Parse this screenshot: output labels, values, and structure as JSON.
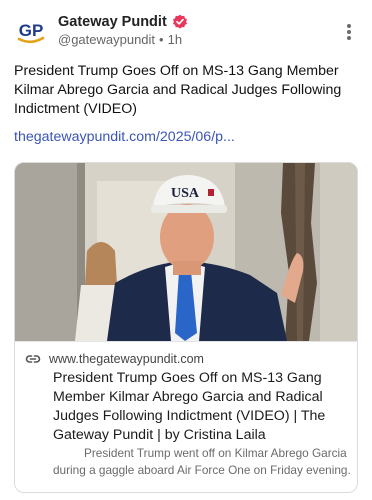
{
  "account": {
    "display_name": "Gateway Pundit",
    "handle": "@gatewaypundit",
    "separator": "•",
    "timestamp": "1h",
    "avatar_text": "GP",
    "verified": true
  },
  "post": {
    "text": "President Trump Goes Off on MS-13 Gang Member Kilmar Abrego Garcia and Radical Judges Following Indictment (VIDEO)",
    "link_text": "thegatewaypundit.com/2025/06/p..."
  },
  "card": {
    "image_cap_text": "USA",
    "domain": "www.thegatewaypundit.com",
    "title": "President Trump Goes Off on MS-13 Gang Member Kilmar Abrego Garcia and Radical Judges Following Indictment (VIDEO) | The Gateway Pundit | by Cristina Laila",
    "description": "President Trump went off on Kilmar Abrego Garcia during a gaggle aboard Air Force One on Friday evening."
  },
  "icons": {
    "avatar": "gateway-pundit-logo-icon",
    "verified": "verified-badge-icon",
    "more": "more-options-icon",
    "link": "link-icon"
  },
  "colors": {
    "link": "#3b55b8",
    "verified": "#e8375a",
    "logo_blue": "#1f3a8a",
    "logo_gold": "#e3a21a"
  }
}
